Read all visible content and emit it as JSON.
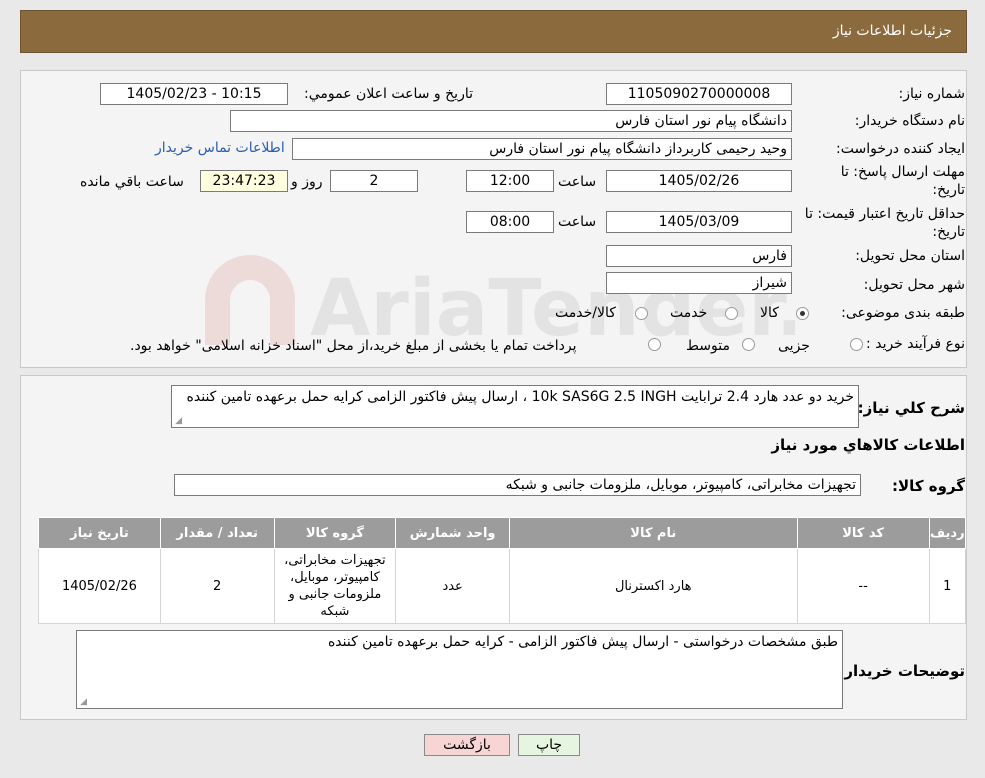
{
  "header": {
    "title": "جزئیات اطلاعات نیاز"
  },
  "need_number": {
    "label": "شماره نیاز:",
    "value": "1105090270000008"
  },
  "announce": {
    "label": "تاریخ و ساعت اعلان عمومي:",
    "value": "1405/02/23 - 10:15"
  },
  "buyer_org": {
    "label": "نام دستگاه خریدار:",
    "value": "دانشگاه پیام نور استان فارس"
  },
  "requester": {
    "label": "ایجاد کننده درخواست:",
    "value": "وحید رحیمی کاربرداز دانشگاه پیام نور استان فارس",
    "contact_link": "اطلاعات تماس خریدار"
  },
  "deadline": {
    "label_line1": "مهلت ارسال پاسخ: تا",
    "label_line2": "تاریخ:",
    "date": "1405/02/26",
    "time_label": "ساعت",
    "time": "12:00",
    "days": "2",
    "days_label": "روز و",
    "remaining": "23:47:23",
    "remaining_label": "ساعت باقي مانده"
  },
  "price_validity": {
    "label_line1": "حداقل تاریخ اعتبار قیمت: تا",
    "label_line2": "تاریخ:",
    "date": "1405/03/09",
    "time_label": "ساعت",
    "time": "08:00"
  },
  "province": {
    "label": "استان محل تحویل:",
    "value": "فارس"
  },
  "city": {
    "label": "شهر محل تحویل:",
    "value": "شیراز"
  },
  "category": {
    "label": "طبقه بندی موضوعی:",
    "options": [
      "کالا",
      "خدمت",
      "کالا/خدمت"
    ],
    "selected": "کالا"
  },
  "process": {
    "label": "نوع فرآیند خرید :",
    "options": [
      "جزیی",
      "متوسط"
    ],
    "note": "پرداخت تمام یا بخشی از مبلغ خرید،از محل \"اسناد خزانه اسلامی\" خواهد بود."
  },
  "general_desc": {
    "label": "شرح کلي نیاز:",
    "value": "خرید دو عدد هارد 2.4 ترابایت 10k SAS6G 2.5 INGH ، ارسال پیش فاکتور الزامی کرایه حمل برعهده تامین کننده"
  },
  "goods_info_title": "اطلاعات کالاهاي مورد نیاز",
  "goods_group": {
    "label": "گروه کالا:",
    "value": "تجهیزات مخابراتی، کامپیوتر، موبایل، ملزومات جانبی و شبکه"
  },
  "table": {
    "headers": [
      "ردیف",
      "کد کالا",
      "نام کالا",
      "واحد شمارش",
      "گروه کالا",
      "تعداد / مقدار",
      "تاریخ نیاز"
    ],
    "rows": [
      [
        "1",
        "--",
        "هارد اکسترنال",
        "عدد",
        "تجهیزات مخابراتی، کامپیوتر، موبایل، ملزومات جانبی و شبکه",
        "2",
        "1405/02/26"
      ]
    ]
  },
  "buyer_notes": {
    "label": "توضیحات خریدار:",
    "value": "طبق مشخصات درخواستی - ارسال پیش فاکتور الزامی - کرایه حمل برعهده تامین کننده"
  },
  "buttons": {
    "print": "چاپ",
    "back": "بازگشت"
  },
  "colors": {
    "header_bg": "#8b6a3e",
    "link": "#2a5db0",
    "back_button_bg": "#f7d5d5",
    "print_button_bg": "#e6f5df",
    "table_header_bg": "#9c9c9c"
  }
}
